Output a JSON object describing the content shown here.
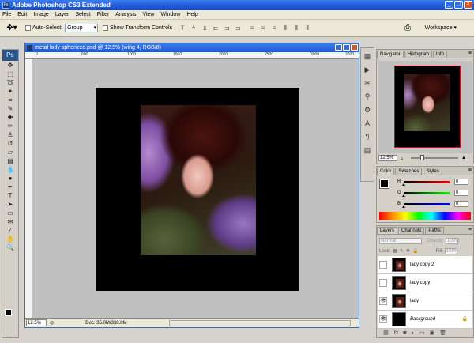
{
  "app": {
    "title": "Adobe Photoshop CS3 Extended",
    "logo": "Ps",
    "win_min": "_",
    "win_max": "□",
    "win_close": "×"
  },
  "menu": [
    "File",
    "Edit",
    "Image",
    "Layer",
    "Select",
    "Filter",
    "Analysis",
    "View",
    "Window",
    "Help"
  ],
  "options": {
    "auto_select_label": "Auto-Select:",
    "auto_select_value": "Group",
    "show_transform_label": "Show Transform Controls",
    "workspace_label": "Workspace ▾"
  },
  "document": {
    "title": "metal lady spherized.psd @ 12.5% (wing 4, RGB/8)",
    "zoom": "12.5%",
    "doc_info": "Doc: 35.0M/338.8M",
    "ruler_ticks": [
      "0",
      "500",
      "1000",
      "1500",
      "2000",
      "2500",
      "3000",
      "3500"
    ]
  },
  "navigator": {
    "tabs": [
      "Navigator",
      "Histogram",
      "Info"
    ],
    "zoom": "12.5%"
  },
  "color_panel": {
    "tabs": [
      "Color",
      "Swatches",
      "Styles"
    ],
    "channels": [
      {
        "label": "R",
        "value": "0"
      },
      {
        "label": "G",
        "value": "0"
      },
      {
        "label": "B",
        "value": "0"
      }
    ]
  },
  "layers_panel": {
    "tabs": [
      "Layers",
      "Channels",
      "Paths"
    ],
    "blend_mode": "Normal",
    "opacity_label": "Opacity:",
    "opacity_value": "100%",
    "lock_label": "Lock:",
    "fill_label": "Fill:",
    "fill_value": "100%",
    "layers": [
      {
        "name": "lady copy 2",
        "visible": false
      },
      {
        "name": "lady copy",
        "visible": false
      },
      {
        "name": "lady",
        "visible": true
      },
      {
        "name": "Background",
        "visible": true
      }
    ]
  },
  "colors": {
    "foreground": "#000000",
    "background": "#ffffff",
    "titlebar": "#1f58d8"
  }
}
